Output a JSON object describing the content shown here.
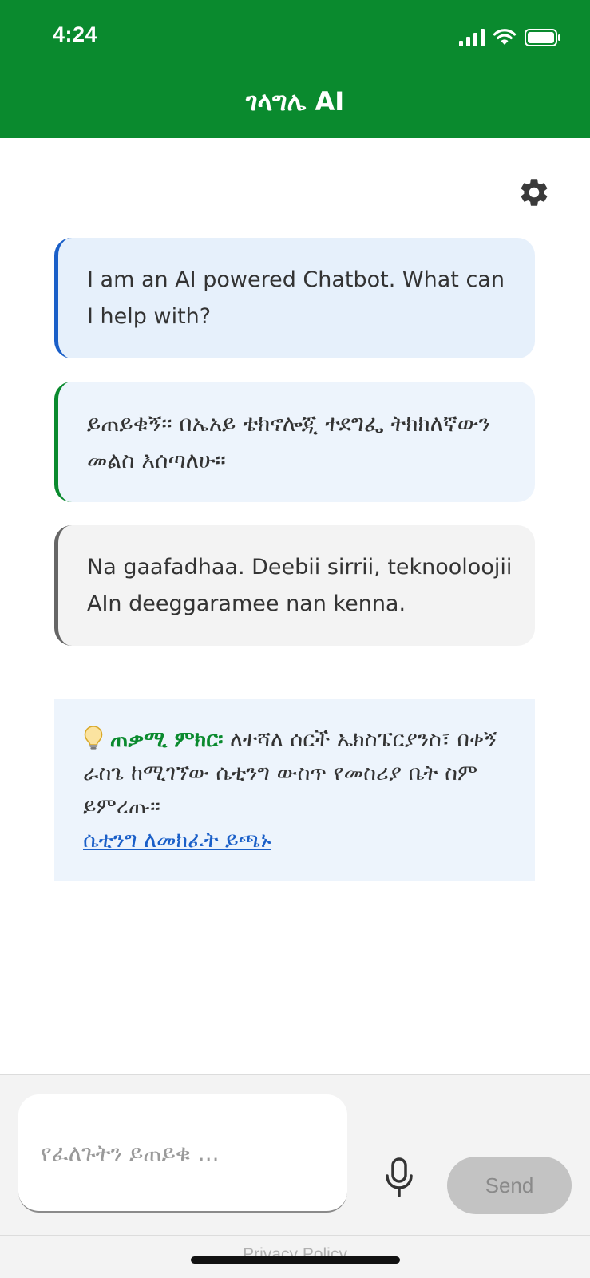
{
  "status_bar": {
    "time": "4:24"
  },
  "header": {
    "title": "ገላግሌ AI"
  },
  "chat": {
    "messages": [
      {
        "lang": "en",
        "text": "I am an AI powered Chatbot. What can I help with?"
      },
      {
        "lang": "am",
        "text": "ይጠይቁኝ፡፡ በኤአይ ቴክኖሎጂ ተደግፌ ትክክለኛውን መልስ እሰጣለሁ፡፡"
      },
      {
        "lang": "om",
        "text": "Na gaafadhaa. Deebii sirrii, teknooloojii AIn deeggaramee nan kenna."
      }
    ]
  },
  "tip": {
    "icon": "lightbulb-icon",
    "label": "ጠቃሚ ምክር፡",
    "text": " ለተሻለ ሰርች ኤክስፔርያንስ፣ በቀኝ ራስጌ ከሚገኘው ሴቲንግ ውስጥ የመስሪያ ቤት ስም ይምረጡ፡፡",
    "link_text": "ሴቲንግ ለመክፈት ይጫኑ"
  },
  "composer": {
    "placeholder": "የፈለጉትን ይጠይቁ ...",
    "value": "",
    "send_label": "Send"
  },
  "footer": {
    "privacy_label": "Privacy Policy"
  },
  "colors": {
    "brand_green": "#0a8a2e",
    "accent_blue": "#1a5fc8",
    "neutral_border": "#666666"
  }
}
